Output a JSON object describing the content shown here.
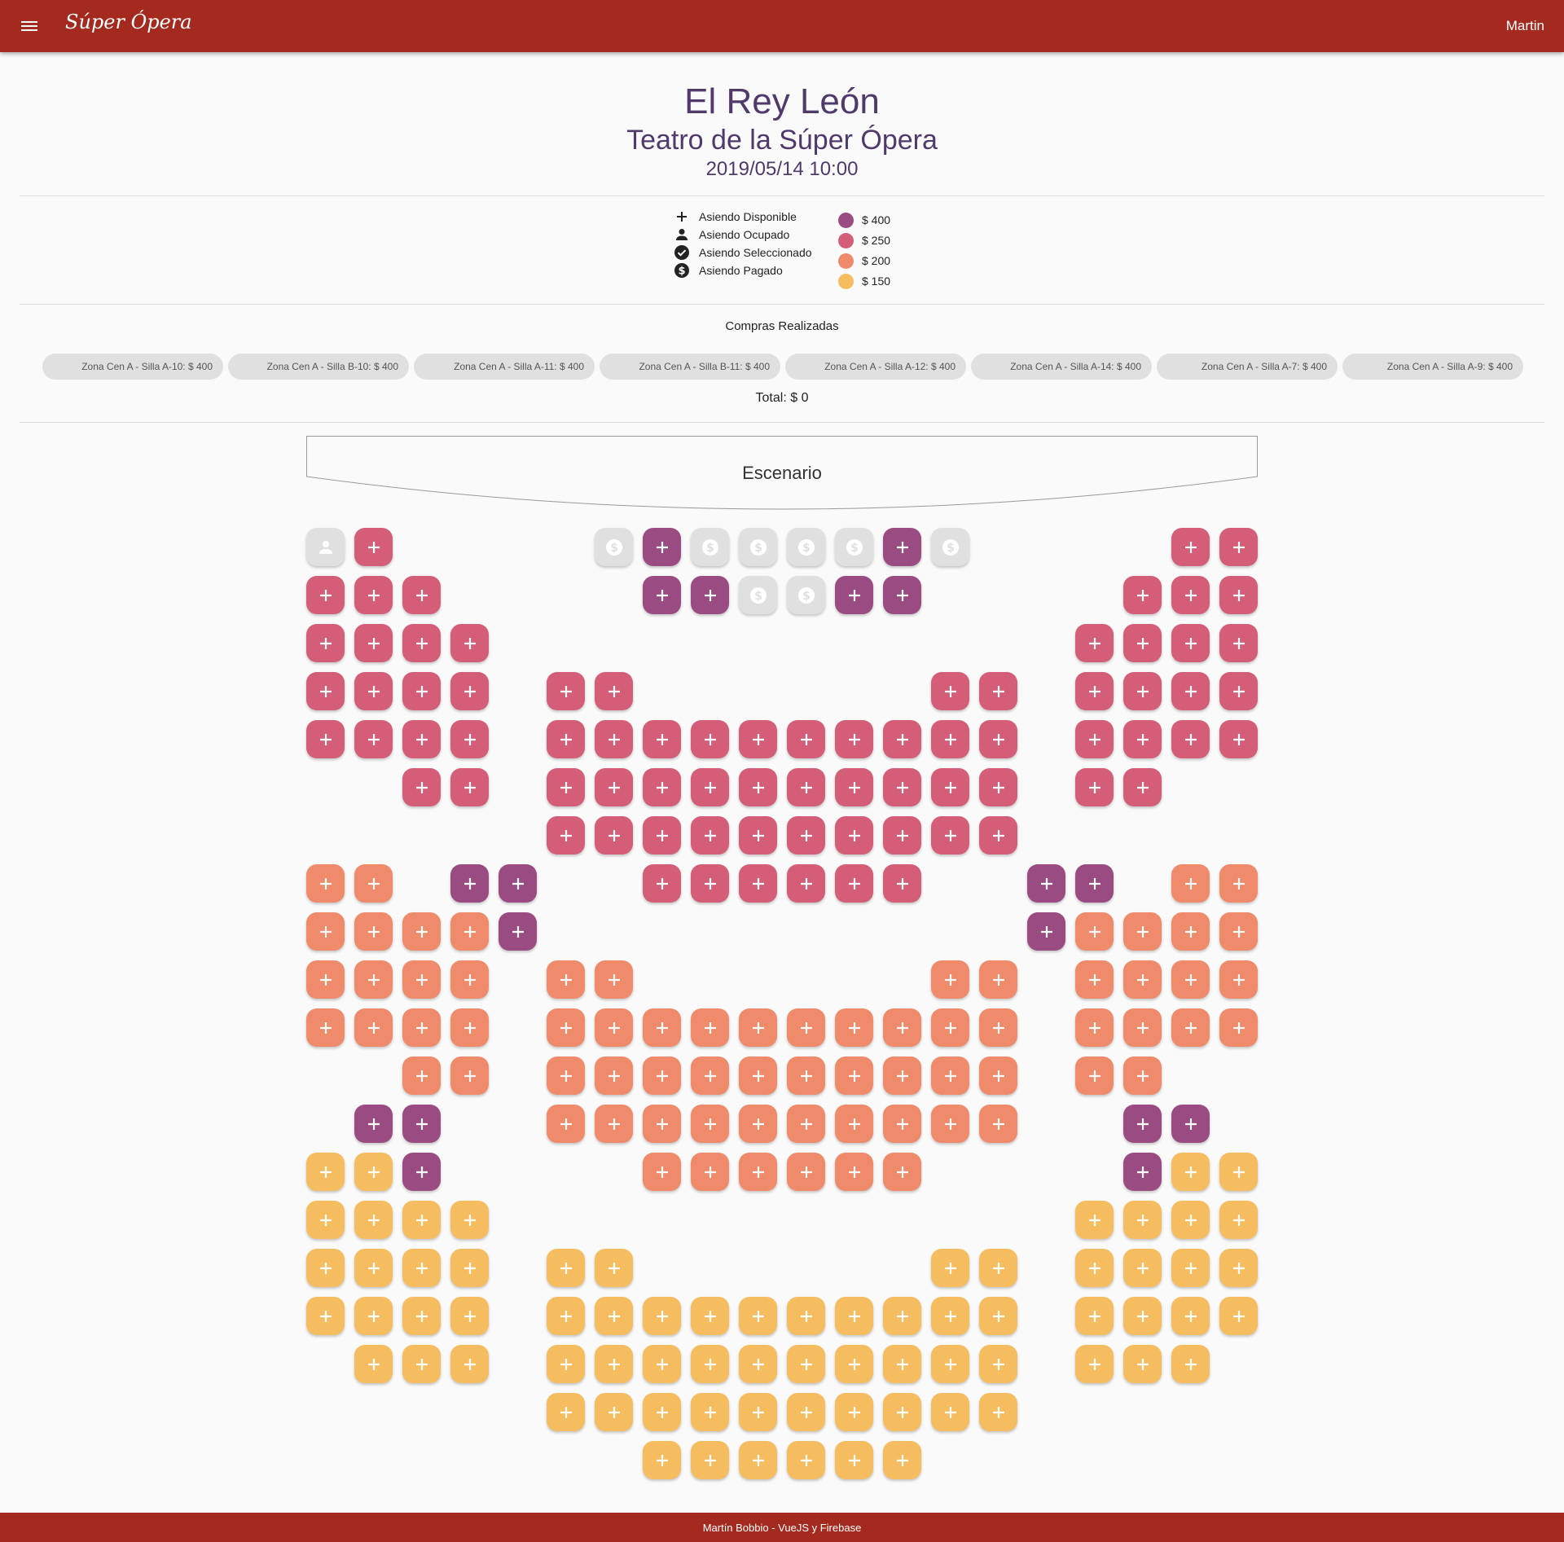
{
  "app": {
    "brand": "Súper Ópera",
    "user": "Martin",
    "menu_icon": "menu-icon"
  },
  "event": {
    "title": "El Rey León",
    "venue": "Teatro de la Súper Ópera",
    "datetime": "2019/05/14 10:00"
  },
  "legend": {
    "states": [
      {
        "icon": "plus-icon",
        "label": "Asiendo Disponible"
      },
      {
        "icon": "person-icon",
        "label": "Asiendo Ocupado"
      },
      {
        "icon": "check-circle-icon",
        "label": "Asiendo Seleccionado"
      },
      {
        "icon": "dollar-circle-icon",
        "label": "Asiendo Pagado"
      }
    ],
    "prices": [
      {
        "label": "$ 400",
        "color": "#9a4b82"
      },
      {
        "label": "$ 250",
        "color": "#d45d78"
      },
      {
        "label": "$ 200",
        "color": "#ef8a6a"
      },
      {
        "label": "$ 150",
        "color": "#f6bd60"
      }
    ]
  },
  "purchases": {
    "title": "Compras Realizadas",
    "items": [
      "Zona Cen A - Silla A-10: $ 400",
      "Zona Cen A - Silla B-10: $ 400",
      "Zona Cen A - Silla A-11: $ 400",
      "Zona Cen A - Silla B-11: $ 400",
      "Zona Cen A - Silla A-12: $ 400",
      "Zona Cen A - Silla A-14: $ 400",
      "Zona Cen A - Silla A-7: $ 400",
      "Zona Cen A - Silla A-9: $ 400"
    ],
    "total": "Total: $ 0"
  },
  "stage": {
    "label": "Escenario"
  },
  "seat_colors": {
    "P": "#9a4b82",
    "R": "#d45d78",
    "O": "#ef8a6a",
    "Y": "#f6bd60",
    "G": "#e0e0e0"
  },
  "seat_grid": [
    "gR.....G$GPG$G$G$G$PG$....RR",
    "RRR.....PPG$G$PP.......RRR",
    "RRRR..................RRRR",
    "RRRR.RR......RR..RRRR",
    "RRRR.RRRRRRRRRR.RRRR",
    "..RR.RRRRRRRRRR.RR..",
    ".....RRRRRRRRRR.....",
    "OO.PP..RRRRRR..PP.OO",
    "OOOOP..........POOOO",
    "OOOO.OO......OO.OOOO",
    "OOOO.OOOOOOOOOO.OOOO",
    "..OO.OOOOOOOOOO.OO..",
    ".PP..OOOOOOOOOO..PP.",
    "YYP....OOOOOO....PYY",
    "YYYY............YYYY",
    "YYYY.YY......YY.YYYY",
    "YYYY.YYYYYYYYYY.YYYY",
    ".YYY.YYYYYYYYYY.YYY.",
    ".....YYYYYYYYYY.....",
    ".......YYYYYY......."
  ],
  "footer": "Martín Bobbio - VueJS y Firebase"
}
